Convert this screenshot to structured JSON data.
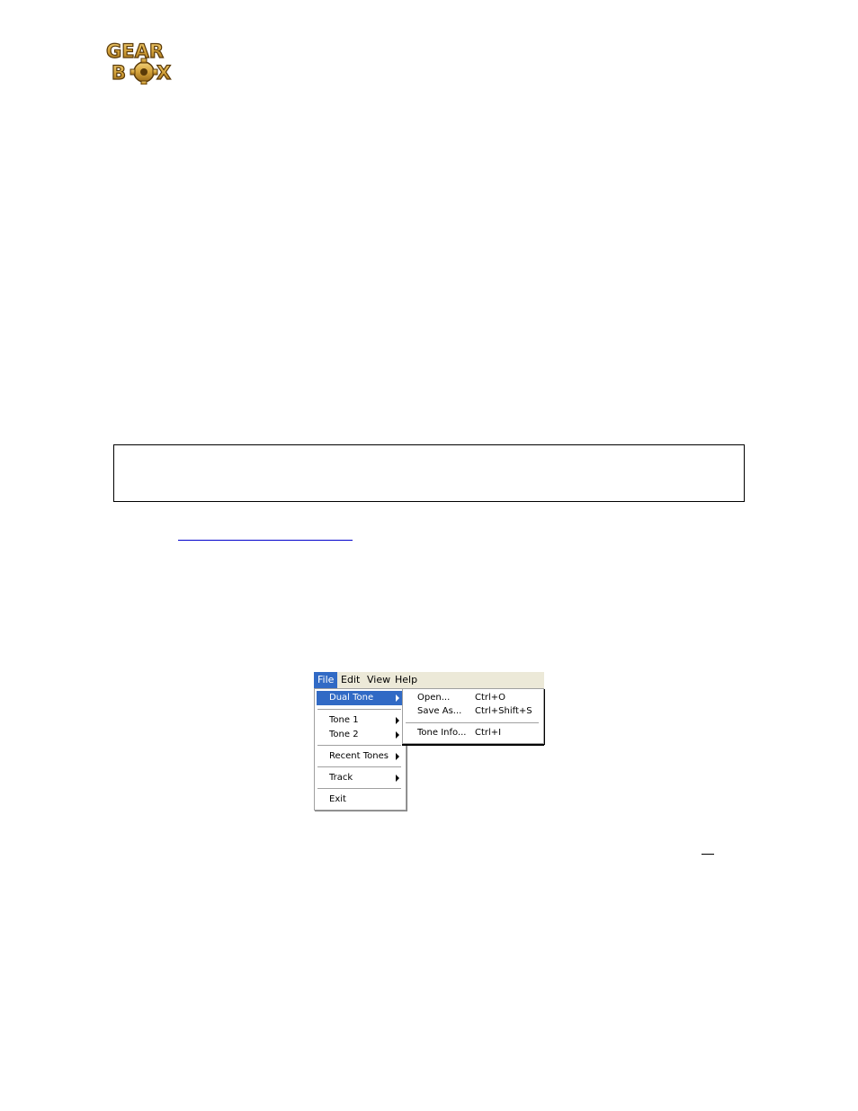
{
  "logo": {
    "text": "GEARBOX",
    "icon": "gearbox-logo-gear-icon"
  },
  "menubar": {
    "items": [
      {
        "label": "File"
      },
      {
        "label": "Edit"
      },
      {
        "label": "View"
      },
      {
        "label": "Help"
      }
    ]
  },
  "file_menu": {
    "items": [
      {
        "label": "Dual Tone"
      },
      {
        "label": "Tone 1"
      },
      {
        "label": "Tone 2"
      },
      {
        "label": "Recent Tones"
      },
      {
        "label": "Track"
      },
      {
        "label": "Exit"
      }
    ]
  },
  "dual_tone_submenu": {
    "items": [
      {
        "label": "Open...",
        "shortcut": "Ctrl+O"
      },
      {
        "label": "Save As...",
        "shortcut": "Ctrl+Shift+S"
      },
      {
        "label": "Tone Info...",
        "shortcut": "Ctrl+I"
      }
    ]
  },
  "colors": {
    "highlight": "#316ac5",
    "menubar_bg": "#ece9d8",
    "logo_gold": "#d4a23a"
  }
}
